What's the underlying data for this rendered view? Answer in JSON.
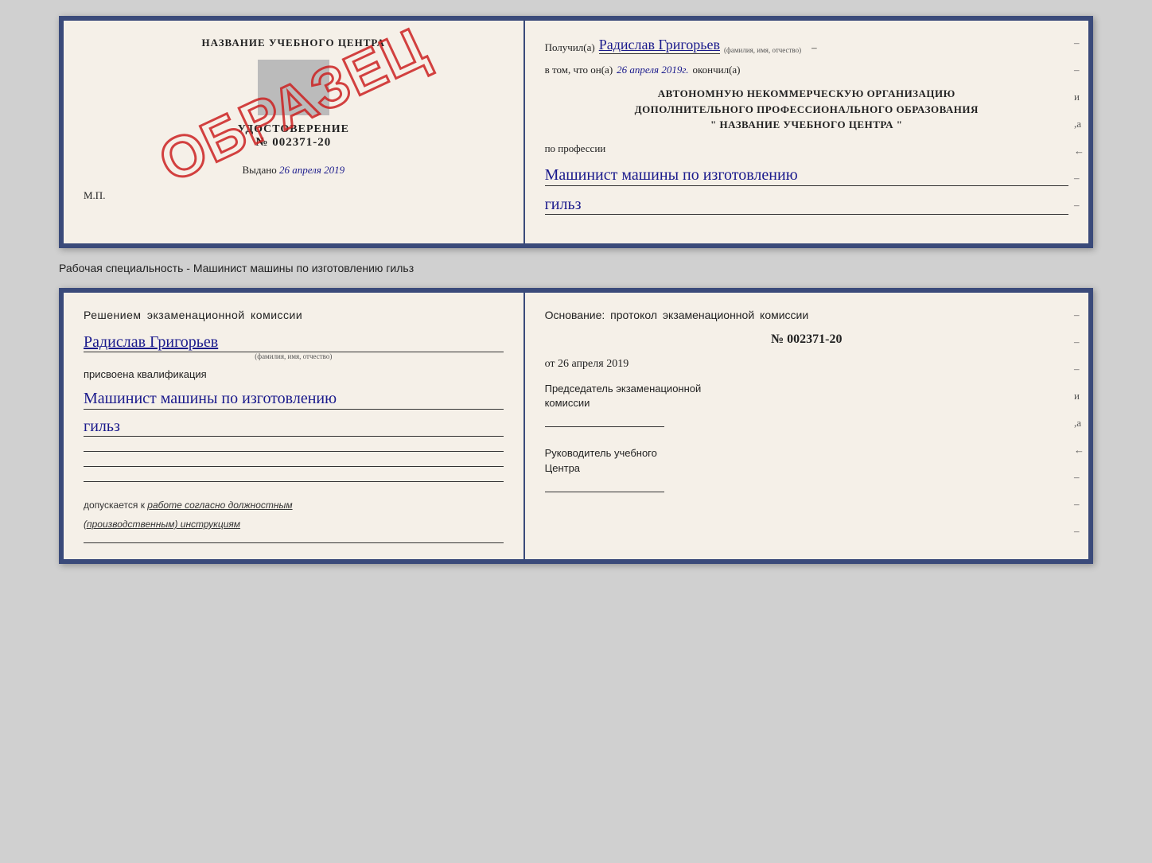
{
  "top_left": {
    "center_title": "НАЗВАНИЕ УЧЕБНОГО ЦЕНТРА",
    "udost_label": "УДОСТОВЕРЕНИЕ",
    "number": "№ 002371-20",
    "vydano": "Выдано",
    "vydano_date": "26 апреля 2019",
    "mp": "М.П.",
    "obrazec": "ОБРАЗЕЦ"
  },
  "top_right": {
    "poluchil": "Получил(а)",
    "name": "Радислав Григорьев",
    "name_label": "(фамилия, имя, отчество)",
    "vtom_prefix": "в том, что он(а)",
    "date": "26 апреля 2019г.",
    "okonchil": "окончил(а)",
    "bold_line1": "АВТОНОМНУЮ НЕКОММЕРЧЕСКУЮ ОРГАНИЗАЦИЮ",
    "bold_line2": "ДОПОЛНИТЕЛЬНОГО ПРОФЕССИОНАЛЬНОГО ОБРАЗОВАНИЯ",
    "bold_line3": "\" НАЗВАНИЕ УЧЕБНОГО ЦЕНТРА \"",
    "po_professii": "по профессии",
    "profession1": "Машинист машины по изготовлению",
    "profession2": "гильз"
  },
  "specialty_label": "Рабочая специальность - Машинист машины по изготовлению гильз",
  "bottom_left": {
    "resheniem": "Решением экзаменационной комиссии",
    "name": "Радислав Григорьев",
    "name_label": "(фамилия, имя, отчество)",
    "prisvoena": "присвоена квалификация",
    "prof1": "Машинист машины по изготовлению",
    "prof2": "гильз",
    "dopuskaetsya": "допускается к",
    "rabote": "работе согласно должностным",
    "instrukciyam": "(производственным) инструкциям"
  },
  "bottom_right": {
    "osnovaniye": "Основание: протокол экзаменационной комиссии",
    "number": "№ 002371-20",
    "ot_prefix": "от",
    "ot_date": "26 апреля 2019",
    "predsedatel_line1": "Председатель экзаменационной",
    "predsedatel_line2": "комиссии",
    "rukovoditel_line1": "Руководитель учебного",
    "rukovoditel_line2": "Центра"
  }
}
